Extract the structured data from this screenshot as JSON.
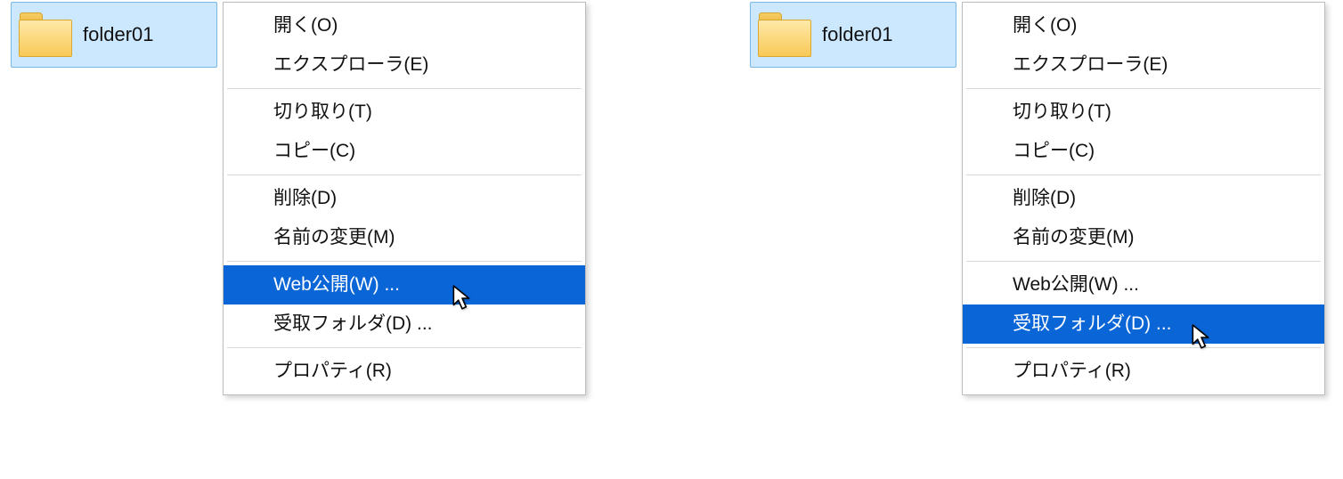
{
  "folder": {
    "name": "folder01"
  },
  "context_menu": {
    "groups": [
      [
        {
          "id": "open",
          "label": "開く(O)"
        },
        {
          "id": "explorer",
          "label": "エクスプローラ(E)"
        }
      ],
      [
        {
          "id": "cut",
          "label": "切り取り(T)"
        },
        {
          "id": "copy",
          "label": "コピー(C)"
        }
      ],
      [
        {
          "id": "delete",
          "label": "削除(D)"
        },
        {
          "id": "rename",
          "label": "名前の変更(M)"
        }
      ],
      [
        {
          "id": "web-publish",
          "label": "Web公開(W) ..."
        },
        {
          "id": "receive-folder",
          "label": "受取フォルダ(D) ..."
        }
      ],
      [
        {
          "id": "properties",
          "label": "プロパティ(R)"
        }
      ]
    ]
  },
  "scenes": [
    {
      "highlight_id": "web-publish",
      "cursor_on_id": "web-publish"
    },
    {
      "highlight_id": "receive-folder",
      "cursor_on_id": "receive-folder"
    }
  ]
}
